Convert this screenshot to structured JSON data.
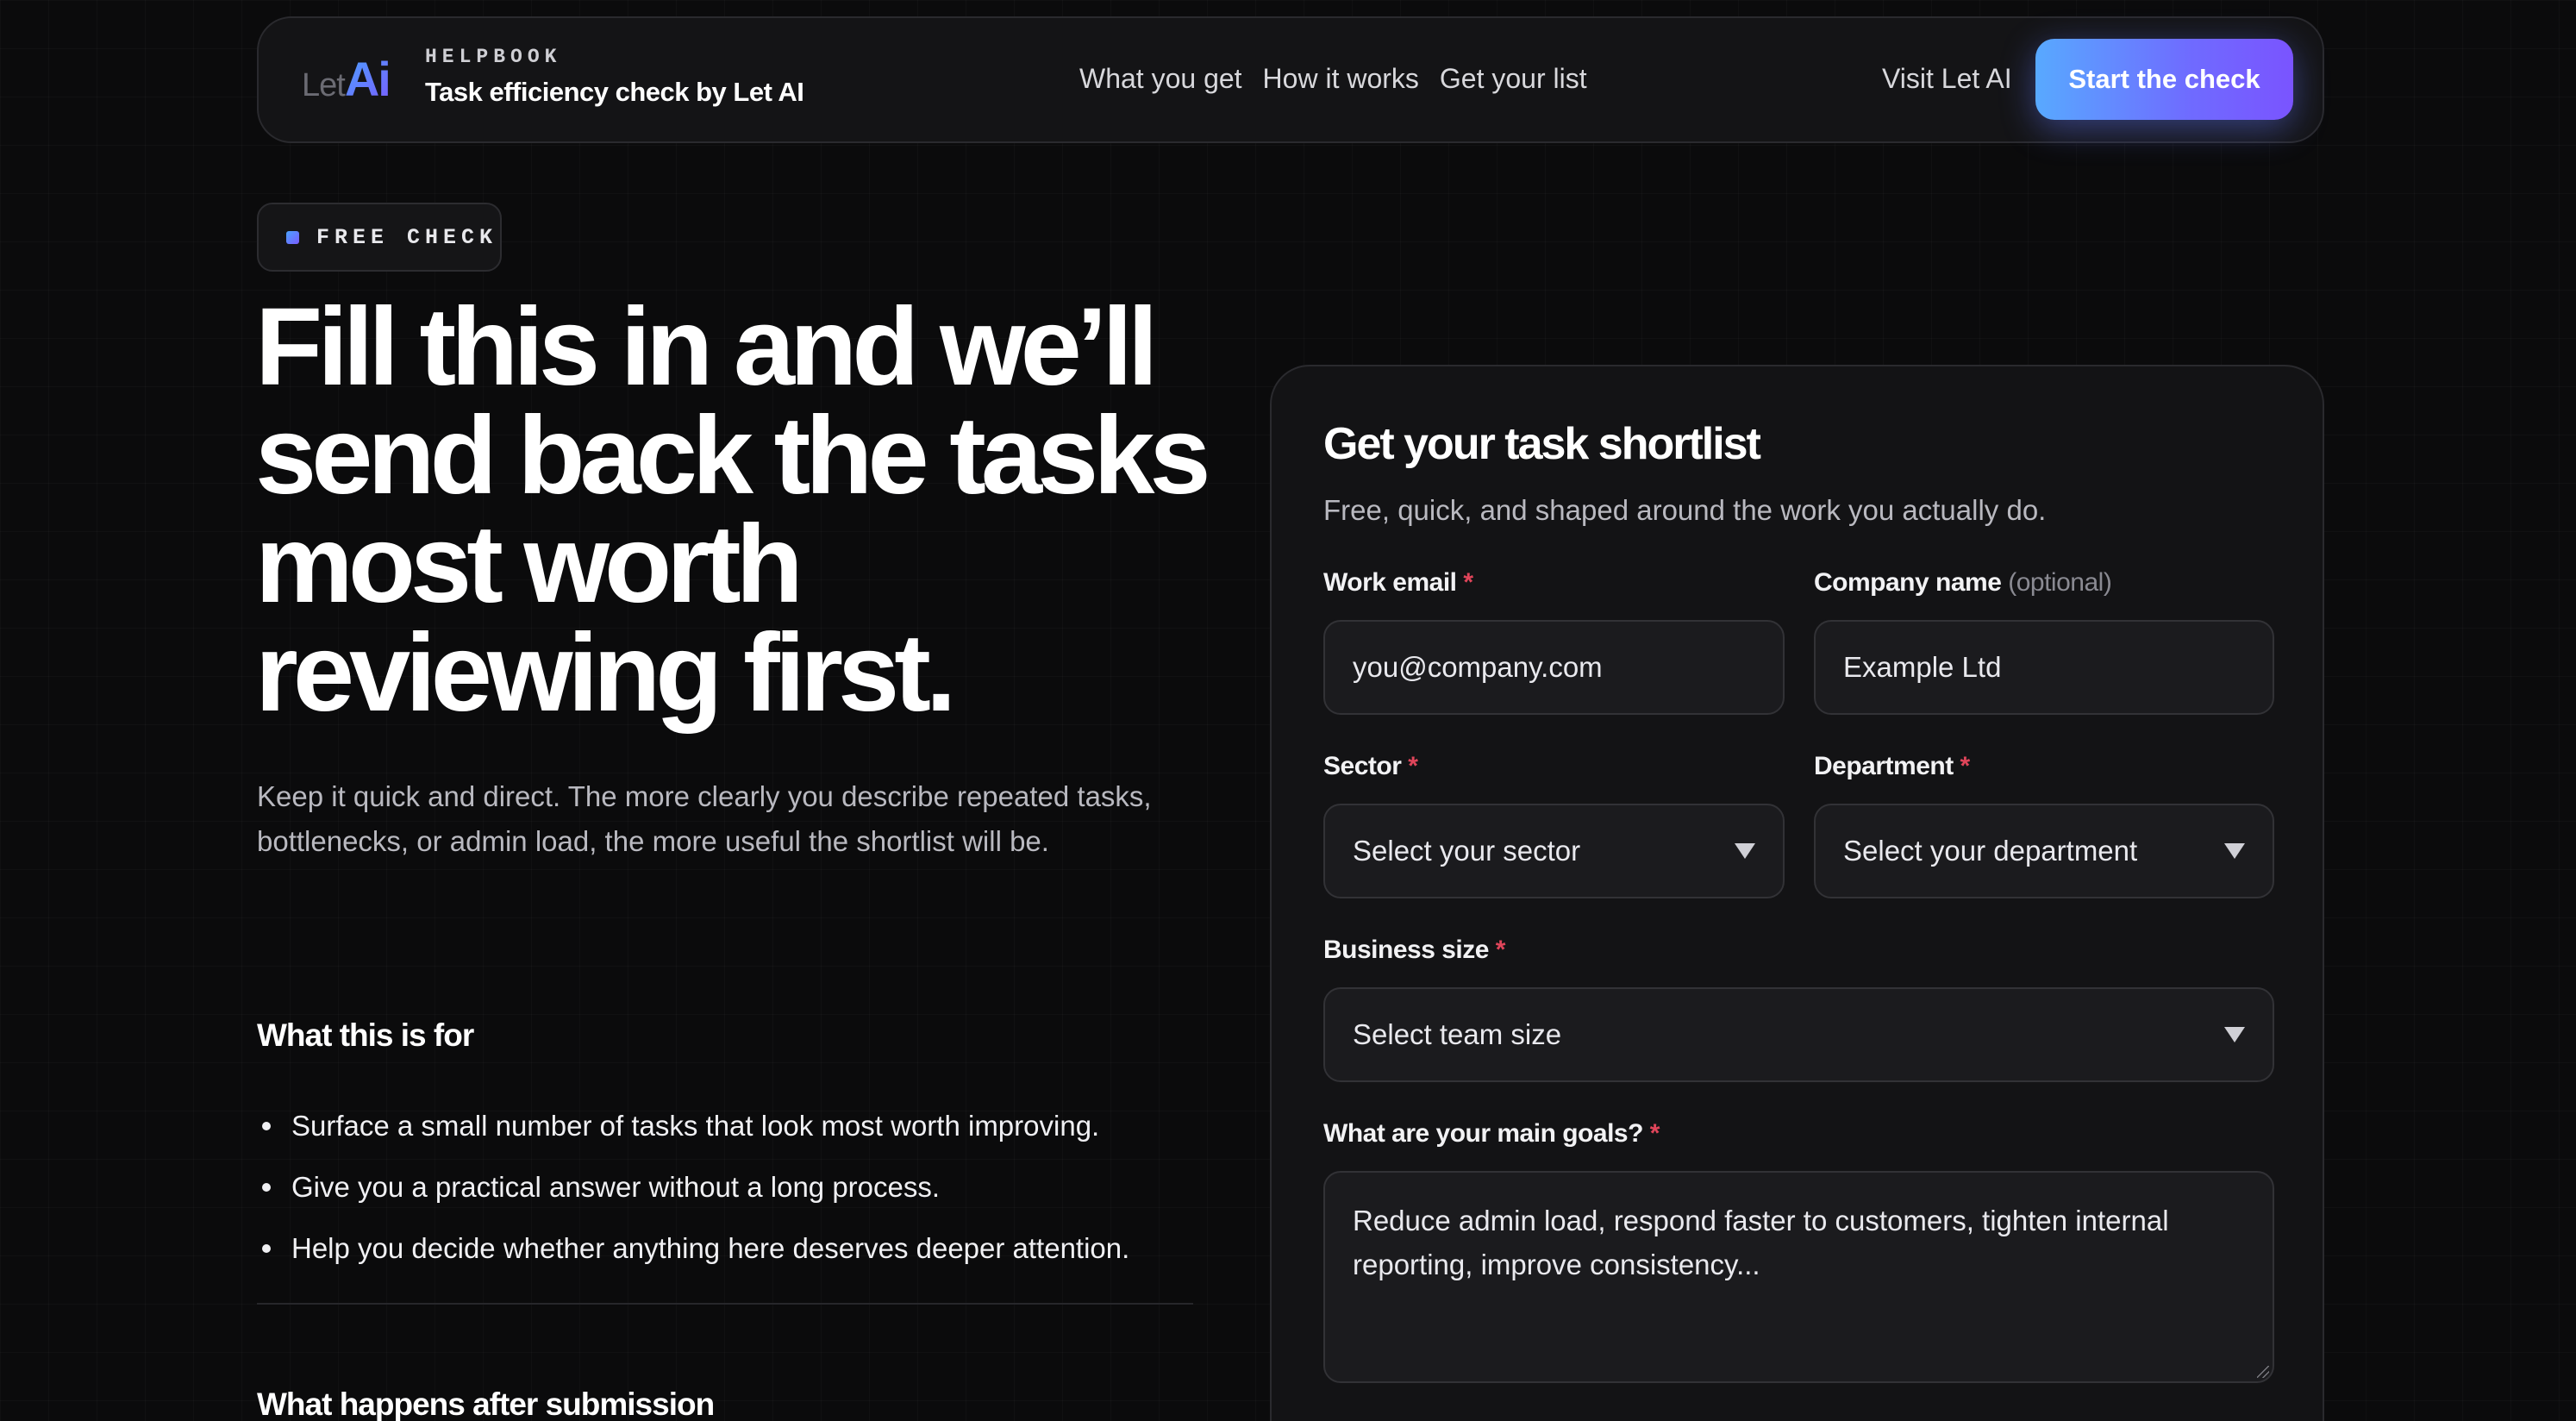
{
  "nav": {
    "logo_let": "Let",
    "logo_ai": "Ai",
    "eyebrow": "HELPBOOK",
    "brand_title": "Task efficiency check by Let AI",
    "links": [
      "What you get",
      "How it works",
      "Get your list"
    ],
    "visit_label": "Visit Let AI",
    "cta_label": "Start the check"
  },
  "hero": {
    "badge": "FREE CHECK",
    "title": "Fill this in and we’ll send back the tasks most worth reviewing first.",
    "subtitle": "Keep it quick and direct. The more clearly you describe repeated tasks, bottlenecks, or admin load, the more useful the shortlist will be."
  },
  "purpose": {
    "heading": "What this is for",
    "bullets": [
      "Surface a small number of tasks that look most worth improving.",
      "Give you a practical answer without a long process.",
      "Help you decide whether anything here deserves deeper attention."
    ]
  },
  "after": {
    "heading": "What happens after submission"
  },
  "form": {
    "title": "Get your task shortlist",
    "subtitle": "Free, quick, and shaped around the work you actually do.",
    "required_mark": "*",
    "email": {
      "label": "Work email",
      "placeholder": "you@company.com"
    },
    "company": {
      "label": "Company name",
      "optional": "(optional)",
      "placeholder": "Example Ltd"
    },
    "sector": {
      "label": "Sector",
      "value": "Select your sector"
    },
    "department": {
      "label": "Department",
      "value": "Select your department"
    },
    "size": {
      "label": "Business size",
      "value": "Select team size"
    },
    "goals": {
      "label": "What are your main goals?",
      "placeholder": "Reduce admin load, respond faster to customers, tighten internal reporting, improve consistency..."
    }
  },
  "colors": {
    "accent_start": "#58a9ff",
    "accent_end": "#7a54ff",
    "required": "#e0455a",
    "background": "#0b0b0c"
  }
}
